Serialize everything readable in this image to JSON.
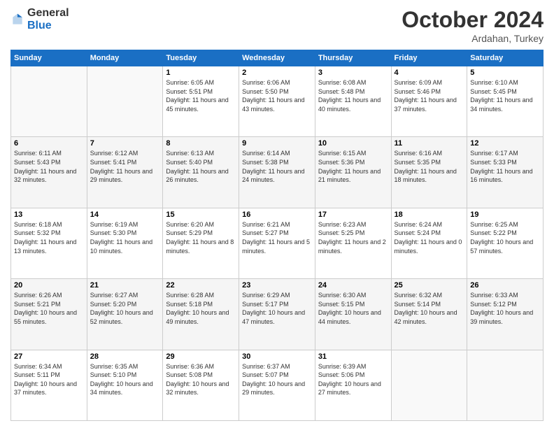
{
  "logo": {
    "general": "General",
    "blue": "Blue"
  },
  "header": {
    "month": "October 2024",
    "location": "Ardahan, Turkey"
  },
  "days_of_week": [
    "Sunday",
    "Monday",
    "Tuesday",
    "Wednesday",
    "Thursday",
    "Friday",
    "Saturday"
  ],
  "weeks": [
    [
      {
        "day": "",
        "info": ""
      },
      {
        "day": "",
        "info": ""
      },
      {
        "day": "1",
        "info": "Sunrise: 6:05 AM\nSunset: 5:51 PM\nDaylight: 11 hours and 45 minutes."
      },
      {
        "day": "2",
        "info": "Sunrise: 6:06 AM\nSunset: 5:50 PM\nDaylight: 11 hours and 43 minutes."
      },
      {
        "day": "3",
        "info": "Sunrise: 6:08 AM\nSunset: 5:48 PM\nDaylight: 11 hours and 40 minutes."
      },
      {
        "day": "4",
        "info": "Sunrise: 6:09 AM\nSunset: 5:46 PM\nDaylight: 11 hours and 37 minutes."
      },
      {
        "day": "5",
        "info": "Sunrise: 6:10 AM\nSunset: 5:45 PM\nDaylight: 11 hours and 34 minutes."
      }
    ],
    [
      {
        "day": "6",
        "info": "Sunrise: 6:11 AM\nSunset: 5:43 PM\nDaylight: 11 hours and 32 minutes."
      },
      {
        "day": "7",
        "info": "Sunrise: 6:12 AM\nSunset: 5:41 PM\nDaylight: 11 hours and 29 minutes."
      },
      {
        "day": "8",
        "info": "Sunrise: 6:13 AM\nSunset: 5:40 PM\nDaylight: 11 hours and 26 minutes."
      },
      {
        "day": "9",
        "info": "Sunrise: 6:14 AM\nSunset: 5:38 PM\nDaylight: 11 hours and 24 minutes."
      },
      {
        "day": "10",
        "info": "Sunrise: 6:15 AM\nSunset: 5:36 PM\nDaylight: 11 hours and 21 minutes."
      },
      {
        "day": "11",
        "info": "Sunrise: 6:16 AM\nSunset: 5:35 PM\nDaylight: 11 hours and 18 minutes."
      },
      {
        "day": "12",
        "info": "Sunrise: 6:17 AM\nSunset: 5:33 PM\nDaylight: 11 hours and 16 minutes."
      }
    ],
    [
      {
        "day": "13",
        "info": "Sunrise: 6:18 AM\nSunset: 5:32 PM\nDaylight: 11 hours and 13 minutes."
      },
      {
        "day": "14",
        "info": "Sunrise: 6:19 AM\nSunset: 5:30 PM\nDaylight: 11 hours and 10 minutes."
      },
      {
        "day": "15",
        "info": "Sunrise: 6:20 AM\nSunset: 5:29 PM\nDaylight: 11 hours and 8 minutes."
      },
      {
        "day": "16",
        "info": "Sunrise: 6:21 AM\nSunset: 5:27 PM\nDaylight: 11 hours and 5 minutes."
      },
      {
        "day": "17",
        "info": "Sunrise: 6:23 AM\nSunset: 5:25 PM\nDaylight: 11 hours and 2 minutes."
      },
      {
        "day": "18",
        "info": "Sunrise: 6:24 AM\nSunset: 5:24 PM\nDaylight: 11 hours and 0 minutes."
      },
      {
        "day": "19",
        "info": "Sunrise: 6:25 AM\nSunset: 5:22 PM\nDaylight: 10 hours and 57 minutes."
      }
    ],
    [
      {
        "day": "20",
        "info": "Sunrise: 6:26 AM\nSunset: 5:21 PM\nDaylight: 10 hours and 55 minutes."
      },
      {
        "day": "21",
        "info": "Sunrise: 6:27 AM\nSunset: 5:20 PM\nDaylight: 10 hours and 52 minutes."
      },
      {
        "day": "22",
        "info": "Sunrise: 6:28 AM\nSunset: 5:18 PM\nDaylight: 10 hours and 49 minutes."
      },
      {
        "day": "23",
        "info": "Sunrise: 6:29 AM\nSunset: 5:17 PM\nDaylight: 10 hours and 47 minutes."
      },
      {
        "day": "24",
        "info": "Sunrise: 6:30 AM\nSunset: 5:15 PM\nDaylight: 10 hours and 44 minutes."
      },
      {
        "day": "25",
        "info": "Sunrise: 6:32 AM\nSunset: 5:14 PM\nDaylight: 10 hours and 42 minutes."
      },
      {
        "day": "26",
        "info": "Sunrise: 6:33 AM\nSunset: 5:12 PM\nDaylight: 10 hours and 39 minutes."
      }
    ],
    [
      {
        "day": "27",
        "info": "Sunrise: 6:34 AM\nSunset: 5:11 PM\nDaylight: 10 hours and 37 minutes."
      },
      {
        "day": "28",
        "info": "Sunrise: 6:35 AM\nSunset: 5:10 PM\nDaylight: 10 hours and 34 minutes."
      },
      {
        "day": "29",
        "info": "Sunrise: 6:36 AM\nSunset: 5:08 PM\nDaylight: 10 hours and 32 minutes."
      },
      {
        "day": "30",
        "info": "Sunrise: 6:37 AM\nSunset: 5:07 PM\nDaylight: 10 hours and 29 minutes."
      },
      {
        "day": "31",
        "info": "Sunrise: 6:39 AM\nSunset: 5:06 PM\nDaylight: 10 hours and 27 minutes."
      },
      {
        "day": "",
        "info": ""
      },
      {
        "day": "",
        "info": ""
      }
    ]
  ]
}
